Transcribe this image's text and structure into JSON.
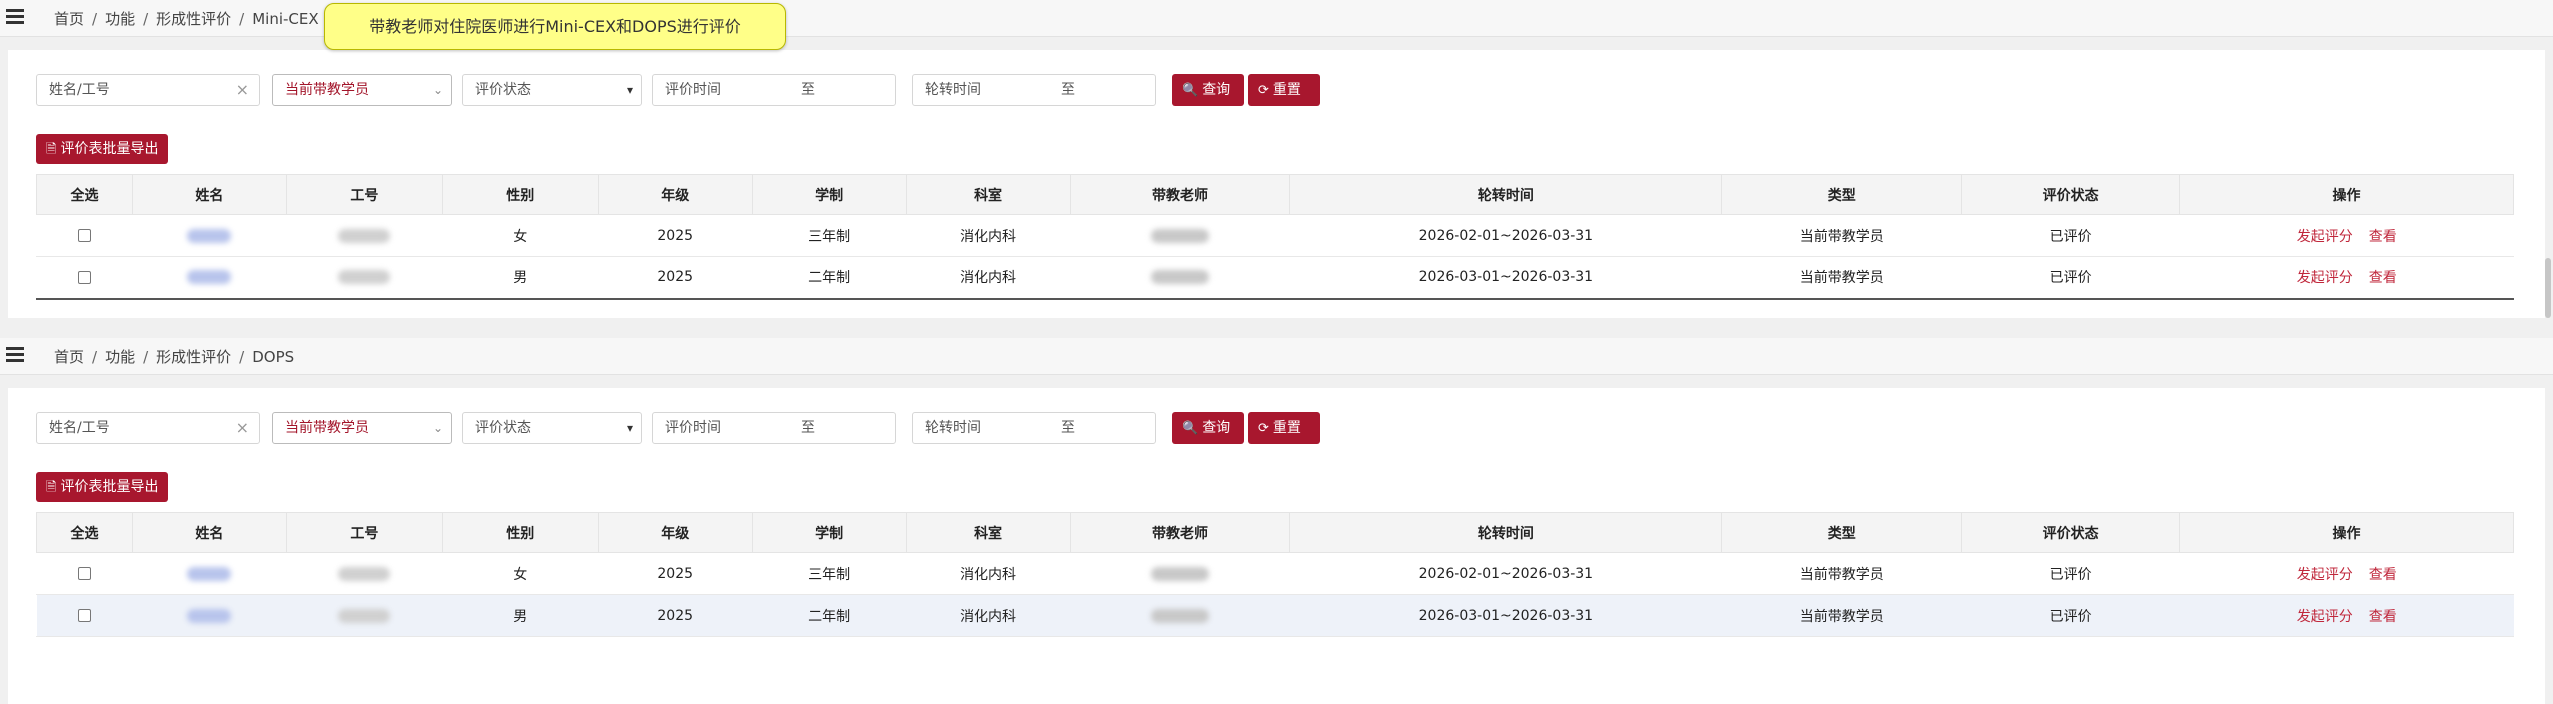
{
  "note": "带教老师对住院医师进行Mini-CEX和DOPS进行评价",
  "sections": [
    {
      "breadcrumb": [
        "首页",
        "功能",
        "形成性评价",
        "Mini-CEX"
      ],
      "filters": {
        "name_placeholder": "姓名/工号",
        "clear": "×",
        "student_select": "当前带教学员",
        "status_select": "评价状态",
        "eval_time": "评价时间",
        "eval_to": "至",
        "rot_time": "轮转时间",
        "rot_to": "至"
      },
      "buttons": {
        "query": "查询",
        "reset": "重置",
        "export": "评价表批量导出"
      },
      "columns": [
        "全选",
        "姓名",
        "工号",
        "性别",
        "年级",
        "学制",
        "科室",
        "带教老师",
        "轮转时间",
        "类型",
        "评价状态",
        "操作"
      ],
      "rows": [
        {
          "gender": "女",
          "grade": "2025",
          "system": "三年制",
          "dept": "消化内科",
          "rotation": "2026-02-01~2026-03-31",
          "type": "当前带教学员",
          "status": "已评价",
          "act1": "发起评分",
          "act2": "查看"
        },
        {
          "gender": "男",
          "grade": "2025",
          "system": "二年制",
          "dept": "消化内科",
          "rotation": "2026-03-01~2026-03-31",
          "type": "当前带教学员",
          "status": "已评价",
          "act1": "发起评分",
          "act2": "查看"
        }
      ]
    },
    {
      "breadcrumb": [
        "首页",
        "功能",
        "形成性评价",
        "DOPS"
      ],
      "filters": {
        "name_placeholder": "姓名/工号",
        "clear": "×",
        "student_select": "当前带教学员",
        "status_select": "评价状态",
        "eval_time": "评价时间",
        "eval_to": "至",
        "rot_time": "轮转时间",
        "rot_to": "至"
      },
      "buttons": {
        "query": "查询",
        "reset": "重置",
        "export": "评价表批量导出"
      },
      "columns": [
        "全选",
        "姓名",
        "工号",
        "性别",
        "年级",
        "学制",
        "科室",
        "带教老师",
        "轮转时间",
        "类型",
        "评价状态",
        "操作"
      ],
      "rows": [
        {
          "gender": "女",
          "grade": "2025",
          "system": "三年制",
          "dept": "消化内科",
          "rotation": "2026-02-01~2026-03-31",
          "type": "当前带教学员",
          "status": "已评价",
          "act1": "发起评分",
          "act2": "查看"
        },
        {
          "gender": "男",
          "grade": "2025",
          "system": "二年制",
          "dept": "消化内科",
          "rotation": "2026-03-01~2026-03-31",
          "type": "当前带教学员",
          "status": "已评价",
          "act1": "发起评分",
          "act2": "查看"
        }
      ]
    }
  ]
}
